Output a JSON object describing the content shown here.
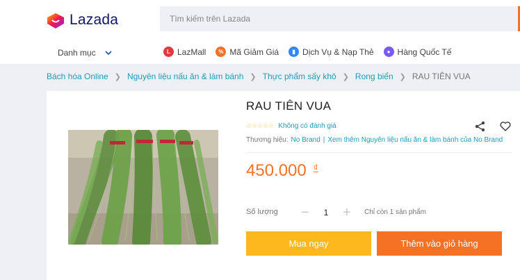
{
  "header": {
    "logo_text": "Lazada",
    "search_placeholder": "Tìm kiếm trên Lazada",
    "category_label": "Danh mục",
    "nav_links": [
      {
        "label": "LazMall",
        "icon": "lazmall-icon",
        "color": "#e4393c"
      },
      {
        "label": "Mã Giảm Giá",
        "icon": "voucher-icon",
        "color": "#f57224"
      },
      {
        "label": "Dịch Vụ & Nạp Thẻ",
        "icon": "topup-icon",
        "color": "#2e89ff"
      },
      {
        "label": "Hàng Quốc Tế",
        "icon": "global-icon",
        "color": "#7a5af5"
      }
    ]
  },
  "breadcrumb": [
    "Bách hóa Online",
    "Nguyên liệu nấu ăn & làm bánh",
    "Thực phẩm sấy khô",
    "Rong biển",
    "RAU TIÊN VUA"
  ],
  "product": {
    "title": "RAU TIÊN VUA",
    "stars": "☆☆☆☆☆",
    "rating_text": "Không có đánh giá",
    "brand_label": "Thương hiệu:",
    "brand_name": "No Brand",
    "brand_more": "Xem thêm Nguyên liệu nấu ăn & làm bánh của No Brand",
    "price": "450.000",
    "currency": "₫",
    "qty_label": "Số lượng",
    "qty_value": "1",
    "stock_text": "Chỉ còn 1 sản phẩm",
    "buy_now": "Mua ngay",
    "add_to_cart": "Thêm vào giỏ hàng"
  },
  "colors": {
    "accent": "#f57224",
    "link": "#1a9cb7",
    "buy": "#fcb81d"
  }
}
